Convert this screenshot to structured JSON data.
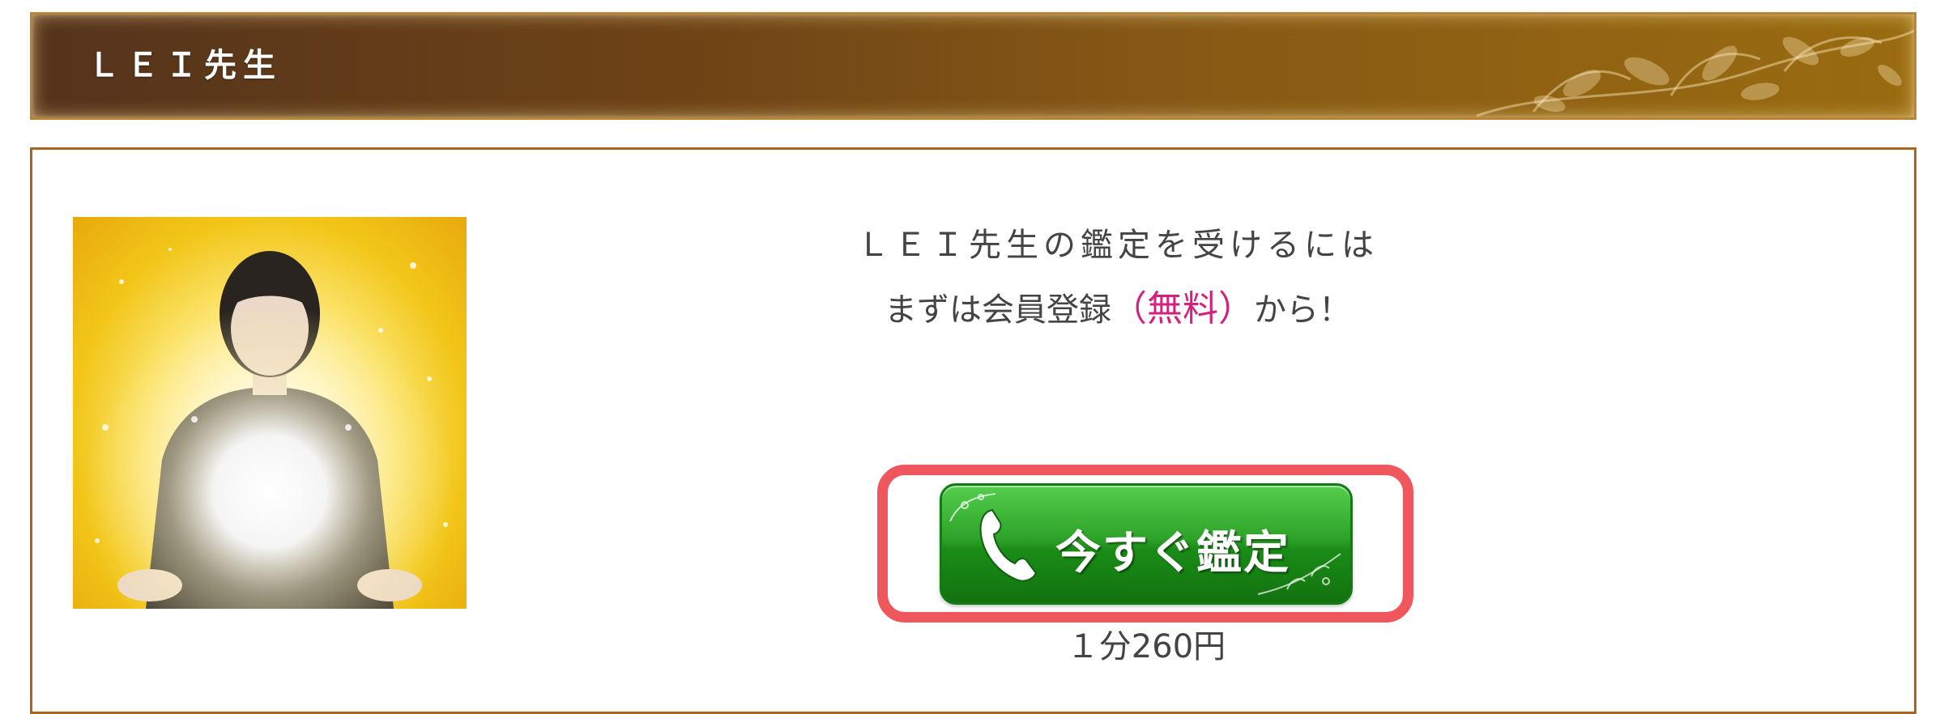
{
  "header": {
    "title": "ＬＥＩ先生"
  },
  "intro": {
    "line1": "ＬＥＩ先生の鑑定を受けるには",
    "line2_before": "まずは会員登録",
    "line2_highlight": "（無料）",
    "line2_after": "から！"
  },
  "call_button": {
    "label": "今すぐ鑑定",
    "icon": "phone-icon"
  },
  "price": {
    "text": "１分260円"
  },
  "colors": {
    "header_brown": "#6e4416",
    "header_gold": "#9a6c10",
    "accent_pink": "#d1237e",
    "button_green": "#2ea32a",
    "highlight_red": "#f0575d",
    "border_brown": "#a9651f"
  }
}
